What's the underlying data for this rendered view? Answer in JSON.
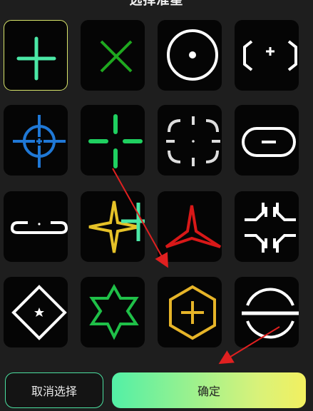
{
  "header": {
    "title": "选择准星"
  },
  "reticles": [
    {
      "name": "plus-crosshair-icon",
      "color": "#4be8a6",
      "selected": true
    },
    {
      "name": "x-crosshair-icon",
      "color": "#1fa81f"
    },
    {
      "name": "circle-dot-crosshair-icon",
      "color": "#ffffff"
    },
    {
      "name": "bracket-plus-crosshair-icon",
      "color": "#ffffff"
    },
    {
      "name": "scope-crosshair-icon",
      "color": "#1f78d6"
    },
    {
      "name": "split-plus-crosshair-icon",
      "color": "#1fd060"
    },
    {
      "name": "dashed-ring-crosshair-icon",
      "color": "#dddddd"
    },
    {
      "name": "capsule-crosshair-icon",
      "color": "#ffffff"
    },
    {
      "name": "slot-crosshair-icon",
      "color": "#ffffff"
    },
    {
      "name": "four-point-star-crosshair-icon",
      "color": "#e6c228"
    },
    {
      "name": "tri-star-crosshair-icon",
      "color": "#d81818"
    },
    {
      "name": "chevron-burst-crosshair-icon",
      "color": "#ffffff"
    },
    {
      "name": "diamond-star-crosshair-icon",
      "color": "#ffffff"
    },
    {
      "name": "hexagram-crosshair-icon",
      "color": "#1fc048"
    },
    {
      "name": "hexagon-plus-crosshair-icon",
      "color": "#e6b428"
    },
    {
      "name": "split-circle-crosshair-icon",
      "color": "#ffffff"
    }
  ],
  "buttons": {
    "cancel_label": "取消选择",
    "confirm_label": "确定"
  },
  "colors": {
    "accent_green": "#52f0a6",
    "accent_yellow": "#f2f060",
    "arrow_red": "#e02020"
  }
}
